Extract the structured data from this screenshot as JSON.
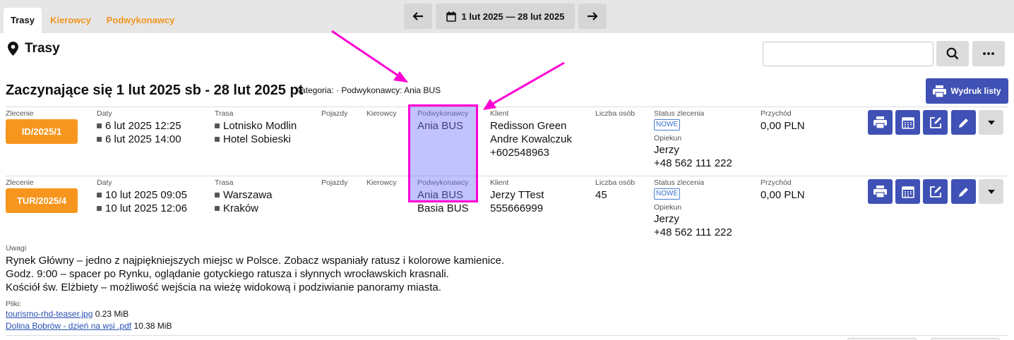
{
  "tabs": [
    "Trasy",
    "Kierowcy",
    "Podwykonawcy"
  ],
  "date_range": "1 lut 2025 — 28 lut 2025",
  "page_title": "Trasy",
  "heading": "Zaczynające się 1 lut 2025 sb - 28 lut 2025 pt",
  "heading_meta": "Kategoria: · Podwykonawcy: Ania BUS",
  "print_list_label": "Wydruk listy",
  "labels": {
    "order": "Zlecenie",
    "dates": "Daty",
    "route": "Trasa",
    "vehicles": "Pojazdy",
    "drivers": "Kierowcy",
    "subcontractors": "Podwykonawcy",
    "client": "Klient",
    "people": "Liczba osób",
    "status": "Status zlecenia",
    "guardian": "Opiekun",
    "income": "Przychód"
  },
  "rows": [
    {
      "order": "ID/2025/1",
      "dates": [
        "6 lut 2025 12:25",
        "6 lut 2025 14:00"
      ],
      "route": [
        "Lotnisko Modlin",
        "Hotel Sobieski"
      ],
      "subcontractors": [
        "Ania BUS"
      ],
      "client": [
        "Redisson Green",
        "Andre Kowalczuk",
        "+602548963"
      ],
      "people": "",
      "status": "NOWE",
      "guardian": [
        "Jerzy",
        "+48 562 111 222"
      ],
      "income": "0,00 PLN"
    },
    {
      "order": "TUR/2025/4",
      "dates": [
        "10 lut 2025 09:05",
        "10 lut 2025 12:06"
      ],
      "route": [
        "Warszawa",
        "Kraków"
      ],
      "subcontractors": [
        "Ania BUS",
        "Basia BUS"
      ],
      "client": [
        "Jerzy TTest",
        "555666999"
      ],
      "people": "45",
      "status": "NOWE",
      "guardian": [
        "Jerzy",
        "+48 562 111 222"
      ],
      "income": "0,00 PLN"
    }
  ],
  "notes_label": "Uwagi",
  "notes": [
    "Rynek Główny – jedno z najpiękniejszych miejsc w Polsce. Zobacz wspaniały ratusz i kolorowe kamienice.",
    "Godz. 9:00 – spacer po Rynku, oglądanie gotyckiego ratusza i słynnych wrocławskich krasnali.",
    "Kościół św. Elżbiety – możliwość wejścia na wieżę widokową i podziwianie panoramy miasta."
  ],
  "files_label": "Pliki:",
  "files": [
    {
      "name": "tourismo-rhd-teaser.jpg",
      "size": "0.23 MiB"
    },
    {
      "name": "Dolina Bobrów - dzień na wsi .pdf",
      "size": "10.38 MiB"
    }
  ],
  "colors": {
    "accent": "#3f51b5",
    "orange": "#f7961e",
    "highlight_border": "#ff00d4"
  }
}
